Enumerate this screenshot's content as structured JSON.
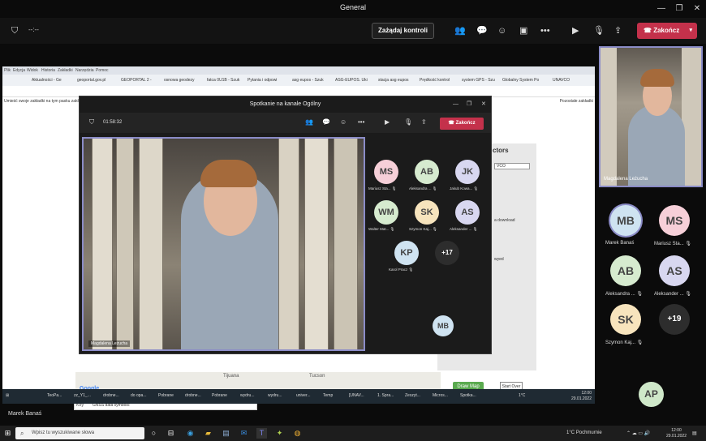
{
  "window": {
    "title": "General",
    "minimize": "—",
    "restore": "❐",
    "close": "✕"
  },
  "toolbar": {
    "timer": "--:--",
    "request_control": "Zażądaj kontroli",
    "end_call": "Zakończ"
  },
  "browser": {
    "menu": [
      "Plik",
      "Edycja",
      "Widok",
      "Historia",
      "Zakładki",
      "Narzędzia",
      "Pomoc"
    ],
    "tabs": [
      "Aktualności - Ge",
      "geoportal.gov.pl",
      "GEOPORTAL 2 - ",
      "osnowa geodezy",
      "fatca 0U1B - Szuk",
      "Pytania i odpowi",
      "asg eupos - Szuk",
      "ASG-EUPOS. Uki",
      "stacja asg eupos",
      "Prędkość kontrol",
      "system GPS - Szu",
      "Globalny System Po",
      "UNAVCO"
    ],
    "bookmarks_hint": "Umieść swoje zakładki na tym pasku zakładek",
    "other_bookmarks": "Pozostałe zakładki"
  },
  "gis": {
    "header": "ctors",
    "select_value": "VCO",
    "text1": "a download",
    "text2": "wyed",
    "draw_map": "Draw Map",
    "start_over": "Start Over",
    "map_labels": [
      "Tijuana",
      "Tucson"
    ],
    "google": "Google",
    "map_credits": "Skróty klawiszowe   Dane do Mapy ©2022 Google, INEGI   100 km   Warunki korzystania z programu   Zgłoś błąd w mapach",
    "gnss_key": "Key",
    "gnss_label": "GNSS data symbols:"
  },
  "inner_taskbar": {
    "items": [
      "TeoPa...",
      "zz_Y1_...",
      "drobne...",
      "do opa...",
      "Pobrane",
      "drobne...",
      "Pobrane",
      "wydru...",
      "wydru...",
      "univer...",
      "Temp",
      "[UNAV...",
      "1. Spra...",
      "Zeszyt...",
      "Micros...",
      "Spotka..."
    ],
    "weather": "1°C",
    "time": "12:00",
    "date": "29.01.2022"
  },
  "meeting": {
    "title": "Spotkanie na kanale Ogólny",
    "timer": "01:58:32",
    "end": "Zakończ",
    "speaker_name": "Magdalena Leżucha",
    "participants": [
      {
        "initials": "MS",
        "name": "Mariusz Sta...",
        "color": "#f6cfd8"
      },
      {
        "initials": "AB",
        "name": "Aleksandra ...",
        "color": "#d6ebcf"
      },
      {
        "initials": "JK",
        "name": "Jakub Kowa...",
        "color": "#d8d7f0"
      },
      {
        "initials": "WM",
        "name": "Walter Mat...",
        "color": "#d6ebcf"
      },
      {
        "initials": "SK",
        "name": "Szymon Kaj...",
        "color": "#f7e4bd"
      },
      {
        "initials": "AS",
        "name": "Aleksander ...",
        "color": "#d8d7f0"
      },
      {
        "initials": "KP",
        "name": "Karol Pracz",
        "color": "#cfe3f1"
      }
    ],
    "more": "+17",
    "self_initials": "MB"
  },
  "right_panel": {
    "video_name": "Magdalena Leżucha",
    "participants": [
      {
        "initials": "MB",
        "name": "Marek Banaś",
        "color": "#cfe3f1"
      },
      {
        "initials": "MS",
        "name": "Mariusz Sta...",
        "color": "#f6cfd8"
      },
      {
        "initials": "AB",
        "name": "Aleksandra ...",
        "color": "#d6ebcf"
      },
      {
        "initials": "AS",
        "name": "Aleksander ...",
        "color": "#d8d7f0"
      },
      {
        "initials": "SK",
        "name": "Szymon Kaj...",
        "color": "#f7e4bd"
      }
    ],
    "more": "+19",
    "self_initials": "AP"
  },
  "footer": {
    "self_name": "Marek Banaś"
  },
  "taskbar": {
    "search_placeholder": "Wpisz tu wyszukiwane słowa",
    "weather": "1°C  Pochmurnie",
    "time": "12:00",
    "date": "29.01.2022"
  }
}
